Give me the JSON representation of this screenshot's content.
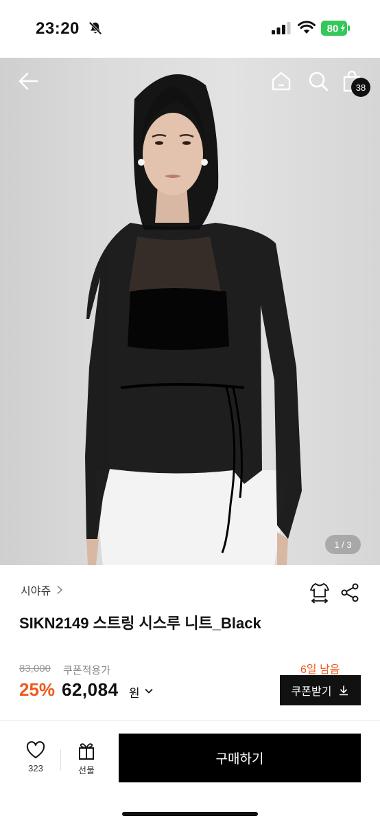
{
  "status_bar": {
    "time": "23:20",
    "battery": "80"
  },
  "header": {
    "cart_count": "38"
  },
  "gallery": {
    "indicator": "1 / 3"
  },
  "product": {
    "brand": "시야쥬",
    "title": "SIKN2149 스트링 시스루 니트_Black",
    "original_price": "83,000",
    "coupon_label": "쿠폰적용가",
    "days_left": "6일 남음",
    "discount_rate": "25%",
    "sale_price": "62,084",
    "currency": "원",
    "coupon_button": "쿠폰받기"
  },
  "bottom_bar": {
    "like_count": "323",
    "gift_label": "선물",
    "buy_label": "구매하기"
  },
  "colors": {
    "accent": "#ee5a1c",
    "primary": "#000000"
  },
  "icons": [
    "bell-off-icon",
    "signal-icon",
    "wifi-icon",
    "battery-icon",
    "back-arrow-icon",
    "home-icon",
    "search-icon",
    "shopping-bag-icon",
    "size-guide-icon",
    "share-icon",
    "chevron-right-icon",
    "chevron-down-icon",
    "download-icon",
    "heart-icon",
    "gift-icon"
  ]
}
